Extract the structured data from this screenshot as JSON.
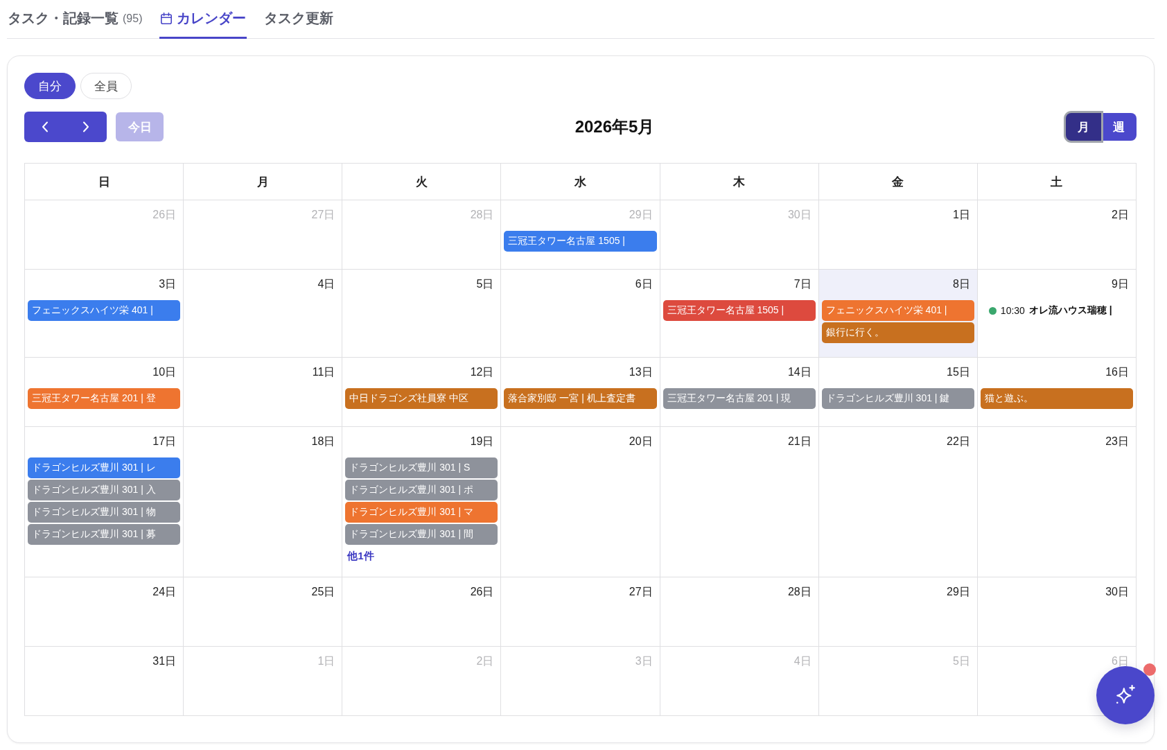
{
  "tabs": [
    {
      "label": "タスク・記録一覧",
      "count": "(95)",
      "kind": "list",
      "selected": false
    },
    {
      "label": "カレンダー",
      "kind": "calendar",
      "selected": true
    },
    {
      "label": "タスク更新",
      "kind": "form",
      "selected": false
    }
  ],
  "scope_toggle": [
    {
      "label": "自分",
      "selected": true
    },
    {
      "label": "全員",
      "selected": false
    }
  ],
  "nav": {
    "today_button": {
      "label": "今日",
      "disabled": true
    }
  },
  "title": "2026年5月",
  "view_switch": [
    {
      "label": "月",
      "selected": true
    },
    {
      "label": "週",
      "selected": false
    }
  ],
  "weekdays": [
    "日",
    "月",
    "火",
    "水",
    "木",
    "金",
    "土"
  ],
  "weeks": [
    [
      {
        "date": "26日",
        "outside": true,
        "today": false
      },
      {
        "date": "27日",
        "outside": true,
        "today": false
      },
      {
        "date": "28日",
        "outside": true,
        "today": false
      },
      {
        "date": "29日",
        "outside": true,
        "today": false,
        "events": [
          {
            "kind": "bar",
            "title": "三冠王タワー名古屋 1505 |",
            "color": "#3b7ded"
          }
        ]
      },
      {
        "date": "30日",
        "outside": true,
        "today": false
      },
      {
        "date": "1日",
        "outside": false,
        "today": false
      },
      {
        "date": "2日",
        "outside": false,
        "today": false
      }
    ],
    [
      {
        "date": "3日",
        "outside": false,
        "today": false,
        "events": [
          {
            "kind": "bar",
            "title": "フェニックスハイツ栄 401 |",
            "color": "#3b7ded"
          }
        ]
      },
      {
        "date": "4日",
        "outside": false,
        "today": false
      },
      {
        "date": "5日",
        "outside": false,
        "today": false
      },
      {
        "date": "6日",
        "outside": false,
        "today": false
      },
      {
        "date": "7日",
        "outside": false,
        "today": false,
        "events": [
          {
            "kind": "bar",
            "title": "三冠王タワー名古屋 1505 |",
            "color": "#dd4a3e"
          }
        ]
      },
      {
        "date": "8日",
        "outside": false,
        "today": true,
        "events": [
          {
            "kind": "bar",
            "title": "フェニックスハイツ栄 401 |",
            "color": "#ee7430"
          },
          {
            "kind": "bar",
            "title": "銀行に行く。",
            "color": "#c8701f"
          }
        ]
      },
      {
        "date": "9日",
        "outside": false,
        "today": false,
        "events": [
          {
            "kind": "dot",
            "time": "10:30",
            "title": "オレ流ハウス瑞穂 |",
            "color": "#3aa76d"
          }
        ]
      }
    ],
    [
      {
        "date": "10日",
        "outside": false,
        "today": false,
        "events": [
          {
            "kind": "bar",
            "title": "三冠王タワー名古屋 201 | 登",
            "color": "#ee7430"
          }
        ]
      },
      {
        "date": "11日",
        "outside": false,
        "today": false
      },
      {
        "date": "12日",
        "outside": false,
        "today": false,
        "events": [
          {
            "kind": "bar",
            "title": "中日ドラゴンズ社員寮 中区",
            "color": "#c8701f"
          }
        ]
      },
      {
        "date": "13日",
        "outside": false,
        "today": false,
        "events": [
          {
            "kind": "bar",
            "title": "落合家別邸 一宮 | 机上査定書",
            "color": "#c8701f"
          }
        ]
      },
      {
        "date": "14日",
        "outside": false,
        "today": false,
        "events": [
          {
            "kind": "bar",
            "title": "三冠王タワー名古屋 201 | 現",
            "color": "#8e929b"
          }
        ]
      },
      {
        "date": "15日",
        "outside": false,
        "today": false,
        "events": [
          {
            "kind": "bar",
            "title": "ドラゴンヒルズ豊川 301 | 鍵",
            "color": "#8e929b"
          }
        ]
      },
      {
        "date": "16日",
        "outside": false,
        "today": false,
        "events": [
          {
            "kind": "bar",
            "title": "猫と遊ぶ。",
            "color": "#c8701f"
          }
        ]
      }
    ],
    [
      {
        "date": "17日",
        "outside": false,
        "today": false,
        "events": [
          {
            "kind": "bar",
            "title": "ドラゴンヒルズ豊川 301 | レ",
            "color": "#3b7ded"
          },
          {
            "kind": "bar",
            "title": "ドラゴンヒルズ豊川 301 | 入",
            "color": "#8e929b"
          },
          {
            "kind": "bar",
            "title": "ドラゴンヒルズ豊川 301 | 物",
            "color": "#8e929b"
          },
          {
            "kind": "bar",
            "title": "ドラゴンヒルズ豊川 301 | 募",
            "color": "#8e929b"
          }
        ]
      },
      {
        "date": "18日",
        "outside": false,
        "today": false
      },
      {
        "date": "19日",
        "outside": false,
        "today": false,
        "events": [
          {
            "kind": "bar",
            "title": "ドラゴンヒルズ豊川 301 | S",
            "color": "#8e929b"
          },
          {
            "kind": "bar",
            "title": "ドラゴンヒルズ豊川 301 | ポ",
            "color": "#8e929b"
          },
          {
            "kind": "bar",
            "title": "ドラゴンヒルズ豊川 301 | マ",
            "color": "#ee7430"
          },
          {
            "kind": "bar",
            "title": "ドラゴンヒルズ豊川 301 | 間",
            "color": "#8e929b"
          }
        ],
        "more": "他1件"
      },
      {
        "date": "20日",
        "outside": false,
        "today": false
      },
      {
        "date": "21日",
        "outside": false,
        "today": false
      },
      {
        "date": "22日",
        "outside": false,
        "today": false
      },
      {
        "date": "23日",
        "outside": false,
        "today": false
      }
    ],
    [
      {
        "date": "24日",
        "outside": false,
        "today": false
      },
      {
        "date": "25日",
        "outside": false,
        "today": false
      },
      {
        "date": "26日",
        "outside": false,
        "today": false
      },
      {
        "date": "27日",
        "outside": false,
        "today": false
      },
      {
        "date": "28日",
        "outside": false,
        "today": false
      },
      {
        "date": "29日",
        "outside": false,
        "today": false
      },
      {
        "date": "30日",
        "outside": false,
        "today": false
      }
    ],
    [
      {
        "date": "31日",
        "outside": false,
        "today": false
      },
      {
        "date": "1日",
        "outside": true,
        "today": false
      },
      {
        "date": "2日",
        "outside": true,
        "today": false
      },
      {
        "date": "3日",
        "outside": true,
        "today": false
      },
      {
        "date": "4日",
        "outside": true,
        "today": false
      },
      {
        "date": "5日",
        "outside": true,
        "today": false
      },
      {
        "date": "6日",
        "outside": true,
        "today": false
      }
    ]
  ],
  "assistant_button": {
    "notification": true
  }
}
